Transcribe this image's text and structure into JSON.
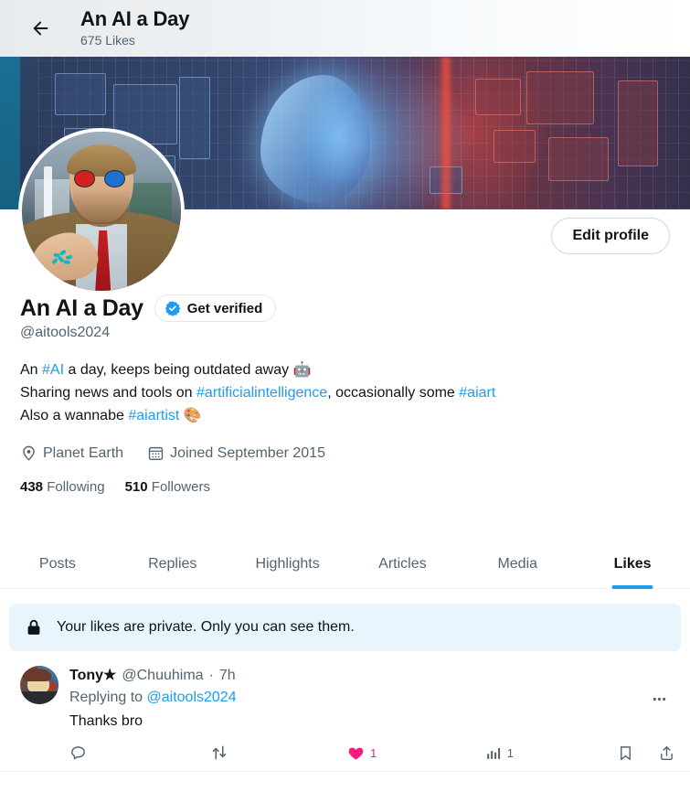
{
  "header": {
    "back_icon": "arrow-left-icon",
    "title": "An AI a Day",
    "subtitle": "675 Likes"
  },
  "profile": {
    "edit_button": "Edit profile",
    "display_name": "An AI a Day",
    "verified_badge_label": "Get verified",
    "verified_icon": "verified-badge-icon",
    "handle": "@aitools2024",
    "bio": {
      "line1_prefix": "An ",
      "line1_tag": "#AI",
      "line1_suffix": " a day, keeps being outdated away ",
      "line1_emoji": "🤖",
      "line2_prefix": "Sharing news and tools on ",
      "line2_tag": "#artificialintelligence",
      "line2_mid": ", occasionally some ",
      "line2_tag2": "#aiart",
      "line3_prefix": "Also a wannabe ",
      "line3_tag": "#aiartist",
      "line3_emoji": "🎨"
    },
    "location_icon": "location-pin-icon",
    "location": "Planet Earth",
    "calendar_icon": "calendar-icon",
    "joined": "Joined September 2015",
    "following_count": "438",
    "following_label": "Following",
    "followers_count": "510",
    "followers_label": "Followers"
  },
  "tabs": [
    {
      "label": "Posts",
      "active": false
    },
    {
      "label": "Replies",
      "active": false
    },
    {
      "label": "Highlights",
      "active": false
    },
    {
      "label": "Articles",
      "active": false
    },
    {
      "label": "Media",
      "active": false
    },
    {
      "label": "Likes",
      "active": true
    }
  ],
  "notice": {
    "icon": "lock-icon",
    "text": "Your likes are private. Only you can see them."
  },
  "tweet": {
    "avatar_name": "tweet-author-avatar",
    "author_name": "Tony★",
    "author_handle": "@Chuuhima",
    "separator": "·",
    "timestamp": "7h",
    "replying_prefix": "Replying to ",
    "replying_mention": "@aitools2024",
    "text": "Thanks bro",
    "more_icon": "more-options-icon",
    "actions": {
      "reply_icon": "reply-icon",
      "reply_count": "",
      "retweet_icon": "retweet-icon",
      "retweet_count": "",
      "like_icon": "heart-filled-icon",
      "like_count": "1",
      "views_icon": "views-chart-icon",
      "views_count": "1",
      "bookmark_icon": "bookmark-icon",
      "share_icon": "share-icon"
    }
  },
  "colors": {
    "accent_blue": "#1d9bf0",
    "like_pink": "#f91880",
    "muted_text": "#536471",
    "primary_text": "#0f1419",
    "notice_bg": "#e8f5fd",
    "border": "#eff3f4"
  }
}
